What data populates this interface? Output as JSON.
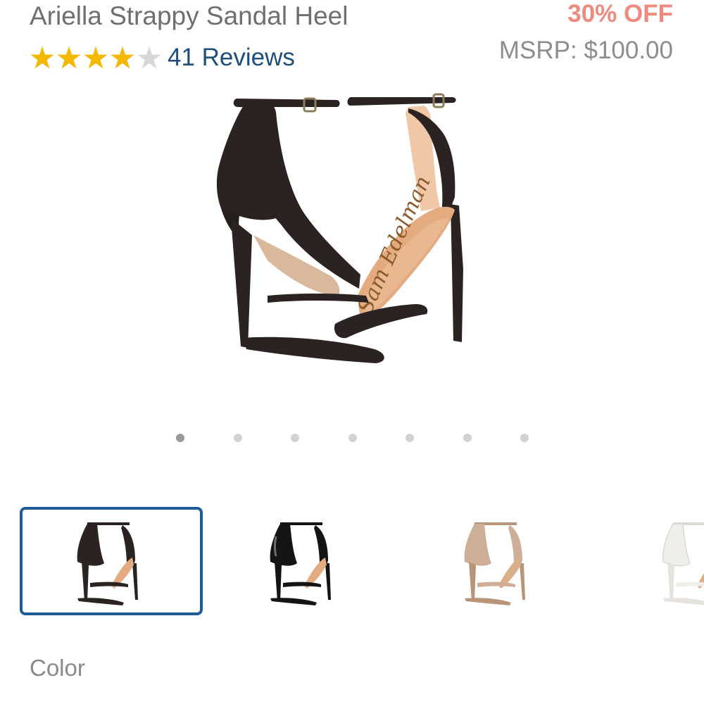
{
  "product": {
    "title": "Ariella Strappy Sandal Heel",
    "discount": "30% OFF",
    "msrp": "MSRP: $100.00",
    "rating": 4,
    "rating_max": 5,
    "reviews_label": "41 Reviews",
    "star_color": "#f5b800",
    "star_empty_color": "#d8d8d8"
  },
  "gallery": {
    "image_count": 7,
    "active_index": 0,
    "main_image_icon": "black-suede-strappy-sandal-heel",
    "sole_brand_text": "Sam Edelman"
  },
  "swatches": [
    {
      "icon": "black-suede-sandal-thumbnail",
      "selected": true,
      "color": "#2a2322"
    },
    {
      "icon": "black-patent-sandal-thumbnail",
      "selected": false,
      "color": "#141414"
    },
    {
      "icon": "nude-metallic-sandal-thumbnail",
      "selected": false,
      "color": "#cfae98"
    },
    {
      "icon": "white-patent-sandal-thumbnail",
      "selected": false,
      "color": "#f0eeea"
    }
  ],
  "color_label": "Color",
  "colors": {
    "accent_blue": "#1d5a9a",
    "link_blue": "#1d4f7a",
    "discount_salmon": "#ef8a7e",
    "text_gray": "#6f6f6f"
  }
}
